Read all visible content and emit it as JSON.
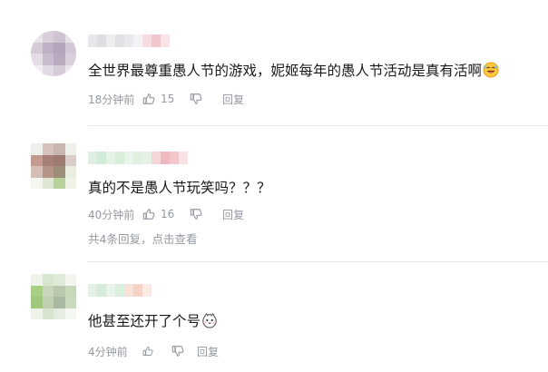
{
  "comments": [
    {
      "text": "全世界最尊重愚人节的游戏，妮姬每年的愚人节活动是真有活啊",
      "emoji": "laughing-face-emoji",
      "time": "18分钟前",
      "likes": "15",
      "reply_label": "回复"
    },
    {
      "text": "真的不是愚人节玩笑吗？？？",
      "time": "40分钟前",
      "likes": "16",
      "reply_label": "回复",
      "replies_summary": {
        "count_text": "共4条回复",
        "separator": "，",
        "action_text": "点击查看"
      }
    },
    {
      "text": "他甚至还开了个号",
      "emoji": "cute-face-emoji",
      "time": "4分钟前",
      "likes": "",
      "reply_label": "回复"
    }
  ],
  "colors": {
    "text_primary": "#18191c",
    "text_secondary": "#9499a0",
    "divider": "#e3e5e7"
  },
  "icons": [
    "thumbs-up-icon",
    "thumbs-down-icon"
  ]
}
